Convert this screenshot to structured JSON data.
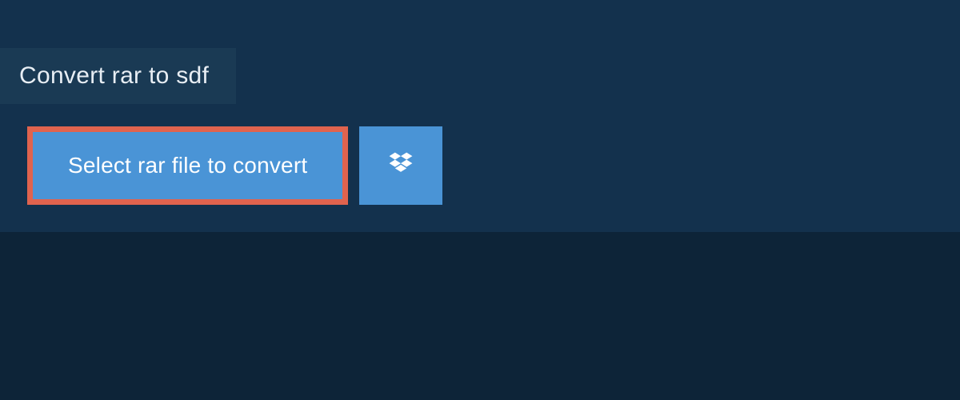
{
  "tab": {
    "label": "Convert rar to sdf"
  },
  "actions": {
    "select_label": "Select rar file to convert"
  },
  "colors": {
    "page_bg": "#0d2438",
    "panel_bg": "#13314d",
    "tab_bg": "#1a3a54",
    "button_bg": "#4a94d6",
    "highlight_border": "#e0634e",
    "text_light": "#ffffff"
  }
}
